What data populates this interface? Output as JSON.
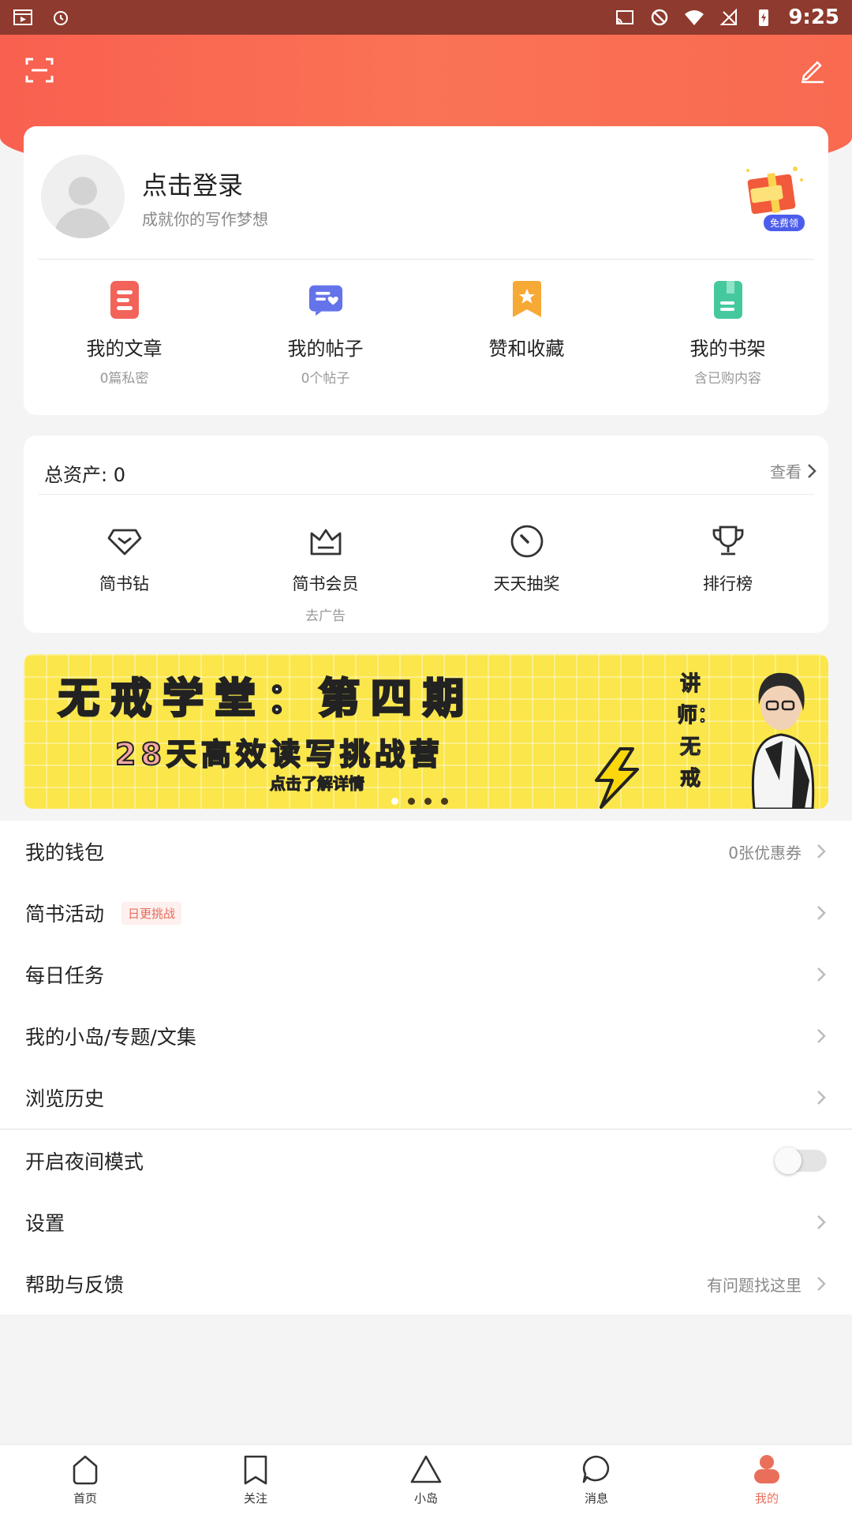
{
  "status_bar": {
    "time": "9:25"
  },
  "profile": {
    "login_title": "点击登录",
    "login_subtitle": "成就你的写作梦想",
    "gift_badge": "免费领",
    "quick_links": [
      {
        "label": "我的文章",
        "sub": "0篇私密",
        "icon": "article-icon",
        "color": "#f2635a"
      },
      {
        "label": "我的帖子",
        "sub": "0个帖子",
        "icon": "post-icon",
        "color": "#6473ea"
      },
      {
        "label": "赞和收藏",
        "sub": "",
        "icon": "star-bookmark-icon",
        "color": "#f6a935"
      },
      {
        "label": "我的书架",
        "sub": "含已购内容",
        "icon": "bookshelf-icon",
        "color": "#46c89f"
      }
    ]
  },
  "assets": {
    "title": "总资产: 0",
    "view_label": "查看",
    "tools": [
      {
        "label": "简书钻",
        "sub": "",
        "icon": "diamond-icon"
      },
      {
        "label": "简书会员",
        "sub": "去广告",
        "icon": "crown-icon"
      },
      {
        "label": "天天抽奖",
        "sub": "",
        "icon": "dial-icon"
      },
      {
        "label": "排行榜",
        "sub": "",
        "icon": "trophy-icon"
      }
    ]
  },
  "banner": {
    "title": "无戒学堂：第四期",
    "subtitle": "28天高效读写挑战营",
    "cta": "点击了解详情",
    "lecturer": "讲师：无戒",
    "page_count": 4,
    "active_index": 0
  },
  "menu": {
    "items": [
      {
        "label": "我的钱包",
        "right": "0张优惠券"
      },
      {
        "label": "简书活动",
        "tag": "日更挑战",
        "right": ""
      },
      {
        "label": "每日任务",
        "right": ""
      },
      {
        "label": "我的小岛/专题/文集",
        "right": ""
      },
      {
        "label": "浏览历史",
        "right": ""
      }
    ],
    "night_mode": {
      "label": "开启夜间模式",
      "enabled": false
    },
    "settings": {
      "label": "设置"
    },
    "help": {
      "label": "帮助与反馈",
      "right": "有问题找这里"
    }
  },
  "bottom_nav": [
    {
      "label": "首页",
      "icon": "home-icon",
      "active": false
    },
    {
      "label": "关注",
      "icon": "bookmark-icon",
      "active": false
    },
    {
      "label": "小岛",
      "icon": "triangle-icon",
      "active": false
    },
    {
      "label": "消息",
      "icon": "message-icon",
      "active": false
    },
    {
      "label": "我的",
      "icon": "person-icon",
      "active": true
    }
  ],
  "colors": {
    "accent": "#ea6f5a",
    "header": "#f9604f",
    "banner": "#fbe64b"
  }
}
